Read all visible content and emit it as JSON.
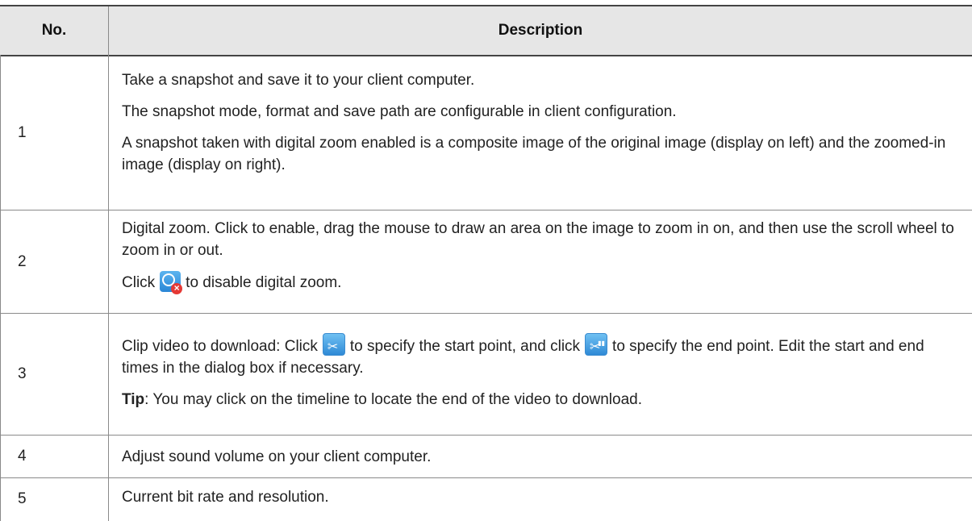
{
  "table": {
    "headers": {
      "no": "No.",
      "description": "Description"
    },
    "rows": [
      {
        "no": "1",
        "p1": "Take a snapshot and save it to your client computer.",
        "p2": "The snapshot mode, format and save path are configurable in client configuration.",
        "p3": "A snapshot taken with digital zoom enabled is a composite image of the original image (display on left) and the zoomed-in image (display on right)."
      },
      {
        "no": "2",
        "p1": "Digital zoom. Click to enable, drag the mouse to draw an area on the image to zoom in on, and then use the scroll wheel to zoom in or out.",
        "p2_before": "Click",
        "p2_icon": "digital-zoom-off-icon",
        "p2_after": "to disable digital zoom."
      },
      {
        "no": "3",
        "p1_a": "Clip video to download: Click",
        "p1_icon1": "clip-start-icon",
        "p1_b": "to specify the start point, and click",
        "p1_icon2": "clip-end-icon",
        "p1_c": "to specify the end point. Edit the start and end times in the dialog box if necessary.",
        "tip_label": "Tip",
        "tip_text": ": You may click on the timeline to locate the end of the video to download."
      },
      {
        "no": "4",
        "p1": "Adjust sound volume on your client computer."
      },
      {
        "no": "5",
        "p1": "Current bit rate and resolution."
      }
    ]
  },
  "colors": {
    "header_bg": "#e6e6e6",
    "border": "#8a8a8a",
    "icon_blue": "#2a86d6",
    "icon_red": "#e53935"
  }
}
